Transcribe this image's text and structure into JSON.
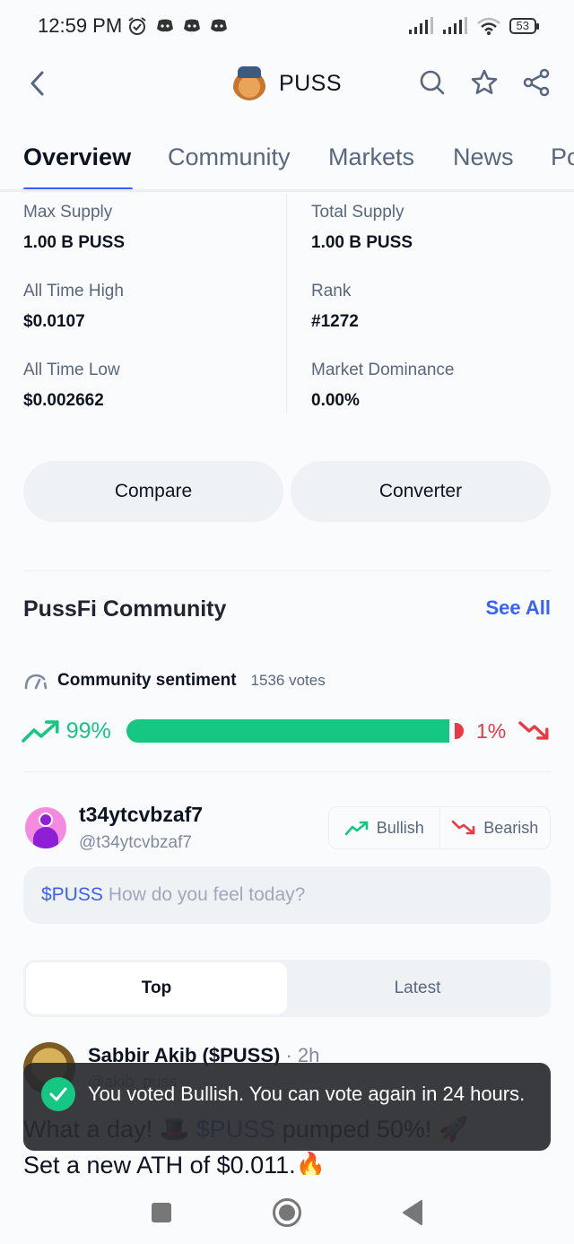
{
  "status_bar": {
    "time": "12:59 PM",
    "battery": "53",
    "left_icons": [
      "alarm-icon",
      "discord-icon",
      "discord-icon",
      "discord-icon"
    ],
    "right_icons": [
      "signal-icon",
      "signal-icon",
      "wifi-icon",
      "battery-icon"
    ]
  },
  "header": {
    "title": "PUSS",
    "icons": [
      "back-icon",
      "search-icon",
      "star-icon",
      "share-icon"
    ]
  },
  "tabs": [
    {
      "label": "Overview",
      "active": true
    },
    {
      "label": "Community",
      "active": false
    },
    {
      "label": "Markets",
      "active": false
    },
    {
      "label": "News",
      "active": false
    },
    {
      "label": "Po",
      "active": false
    }
  ],
  "stats": [
    {
      "label": "Max Supply",
      "value": "1.00 B PUSS"
    },
    {
      "label": "Total Supply",
      "value": "1.00 B PUSS"
    },
    {
      "label": "All Time High",
      "value": "$0.0107"
    },
    {
      "label": "Rank",
      "value": "#1272"
    },
    {
      "label": "All Time Low",
      "value": "$0.002662"
    },
    {
      "label": "Market Dominance",
      "value": "0.00%"
    }
  ],
  "actions": {
    "compare": "Compare",
    "converter": "Converter"
  },
  "community": {
    "title": "PussFi Community",
    "see_all": "See All",
    "sentiment_title": "Community sentiment",
    "votes": "1536 votes",
    "bullish_pct_label": "99%",
    "bearish_pct_label": "1%",
    "bullish_fraction": 0.99,
    "colors": {
      "bullish": "#16c784",
      "bearish": "#ea3943",
      "accent": "#3861fb"
    }
  },
  "composer": {
    "username": "t34ytcvbzaf7",
    "handle": "@t34ytcvbzaf7",
    "bullish_label": "Bullish",
    "bearish_label": "Bearish",
    "tag": "$PUSS",
    "placeholder": "How do you feel today?"
  },
  "feed_tabs": [
    {
      "label": "Top",
      "active": true
    },
    {
      "label": "Latest",
      "active": false
    }
  ],
  "post": {
    "author": "Sabbir Akib ($PUSS)",
    "time": "· 2h",
    "handle": "@akib_puss",
    "line1_pre": "What a day! 🎩",
    "line1_tag": "$PUSS",
    "line1_post": "pumped 50%! 🚀",
    "line2": "Set a new ATH of $0.011.🔥"
  },
  "toast": {
    "message": "You voted Bullish. You can vote again in 24 hours."
  },
  "navbar": {
    "icons": [
      "recents-icon",
      "home-icon",
      "back-nav-icon"
    ]
  }
}
